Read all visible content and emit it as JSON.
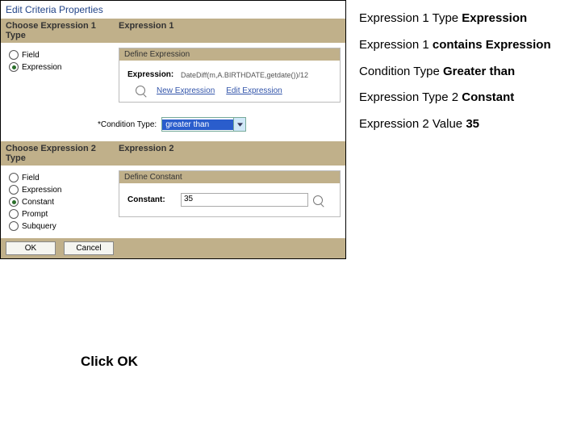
{
  "window": {
    "title": "Edit Criteria Properties"
  },
  "section1": {
    "left": "Choose Expression 1 Type",
    "right": "Expression 1"
  },
  "radios1": {
    "field": "Field",
    "expression": "Expression"
  },
  "defineExpr": {
    "header": "Define Expression",
    "label": "Expression:",
    "value": "DateDiff(m,A.BIRTHDATE,getdate())/12",
    "newLink": "New Expression",
    "editLink": "Edit Expression"
  },
  "condition": {
    "label": "*Condition Type:",
    "value": "greater than"
  },
  "section2": {
    "left": "Choose Expression 2 Type",
    "right": "Expression 2"
  },
  "radios2": {
    "field": "Field",
    "expression": "Expression",
    "constant": "Constant",
    "prompt": "Prompt",
    "subquery": "Subquery"
  },
  "defineConst": {
    "header": "Define Constant",
    "label": "Constant:",
    "value": "35"
  },
  "buttons": {
    "ok": "OK",
    "cancel": "Cancel"
  },
  "anno": {
    "l1a": "Expression 1 Type ",
    "l1b": "Expression",
    "l2a": "Expression 1 ",
    "l2b": "contains Expression",
    "l3a": "Condition Type ",
    "l3b": "Greater than",
    "l4a": "Expression Type 2 ",
    "l4b": "Constant",
    "l5a": "Expression 2 Value ",
    "l5b": "35"
  },
  "clickOk": "Click OK"
}
